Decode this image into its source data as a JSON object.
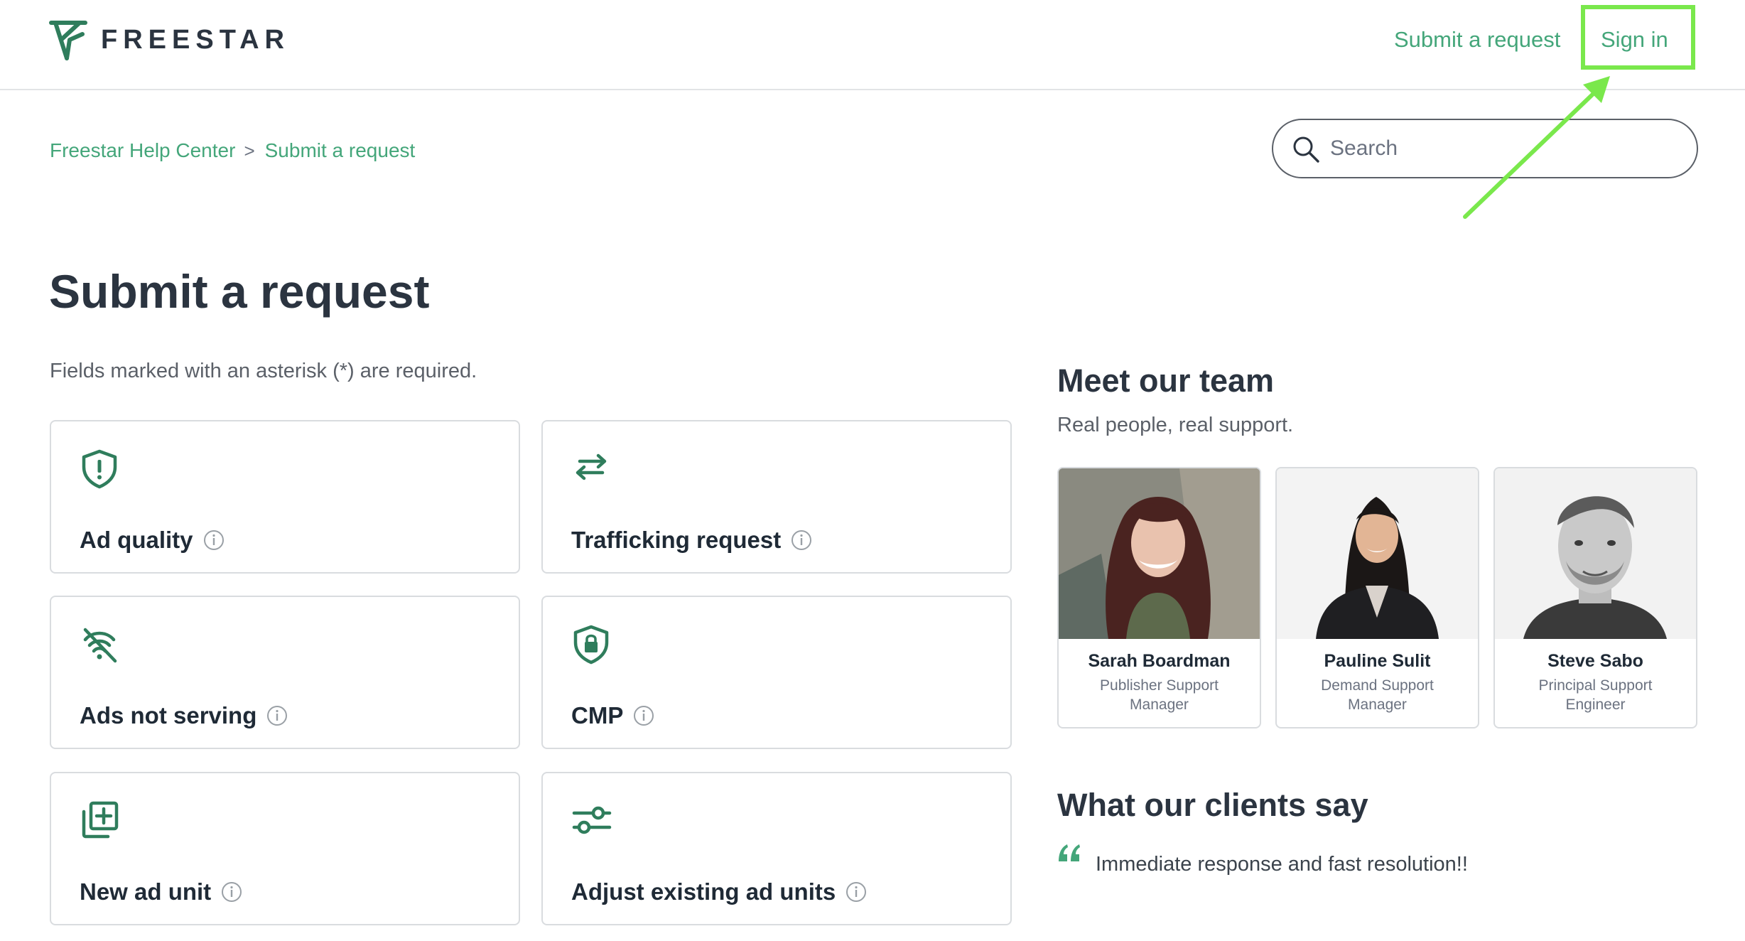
{
  "header": {
    "logo_text": "FREESTAR",
    "nav": {
      "submit_request": "Submit a request",
      "sign_in": "Sign in"
    }
  },
  "breadcrumb": {
    "items": [
      "Freestar Help Center",
      "Submit a request"
    ],
    "separator": ">"
  },
  "search": {
    "placeholder": "Search"
  },
  "main": {
    "title": "Submit a request",
    "required_note": "Fields marked with an asterisk (*) are required.",
    "request_types": [
      {
        "label": "Ad quality",
        "icon": "shield-alert-icon"
      },
      {
        "label": "Trafficking request",
        "icon": "swap-arrows-icon"
      },
      {
        "label": "Ads not serving",
        "icon": "signal-off-icon"
      },
      {
        "label": "CMP",
        "icon": "shield-lock-icon"
      },
      {
        "label": "New ad unit",
        "icon": "add-layers-icon"
      },
      {
        "label": "Adjust existing ad units",
        "icon": "sliders-icon"
      }
    ]
  },
  "sidebar": {
    "team_title": "Meet our team",
    "team_subtitle": "Real people, real support.",
    "team": [
      {
        "name": "Sarah Boardman",
        "role": "Publisher Support Manager"
      },
      {
        "name": "Pauline Sulit",
        "role": "Demand Support Manager"
      },
      {
        "name": "Steve Sabo",
        "role": "Principal Support Engineer"
      }
    ],
    "clients_title": "What our clients say",
    "quote": "Immediate response and fast resolution!!"
  },
  "colors": {
    "brand_green": "#44a67a",
    "icon_green": "#2f7d5c",
    "highlight": "#7ae84c",
    "text_dark": "#2b3440"
  }
}
